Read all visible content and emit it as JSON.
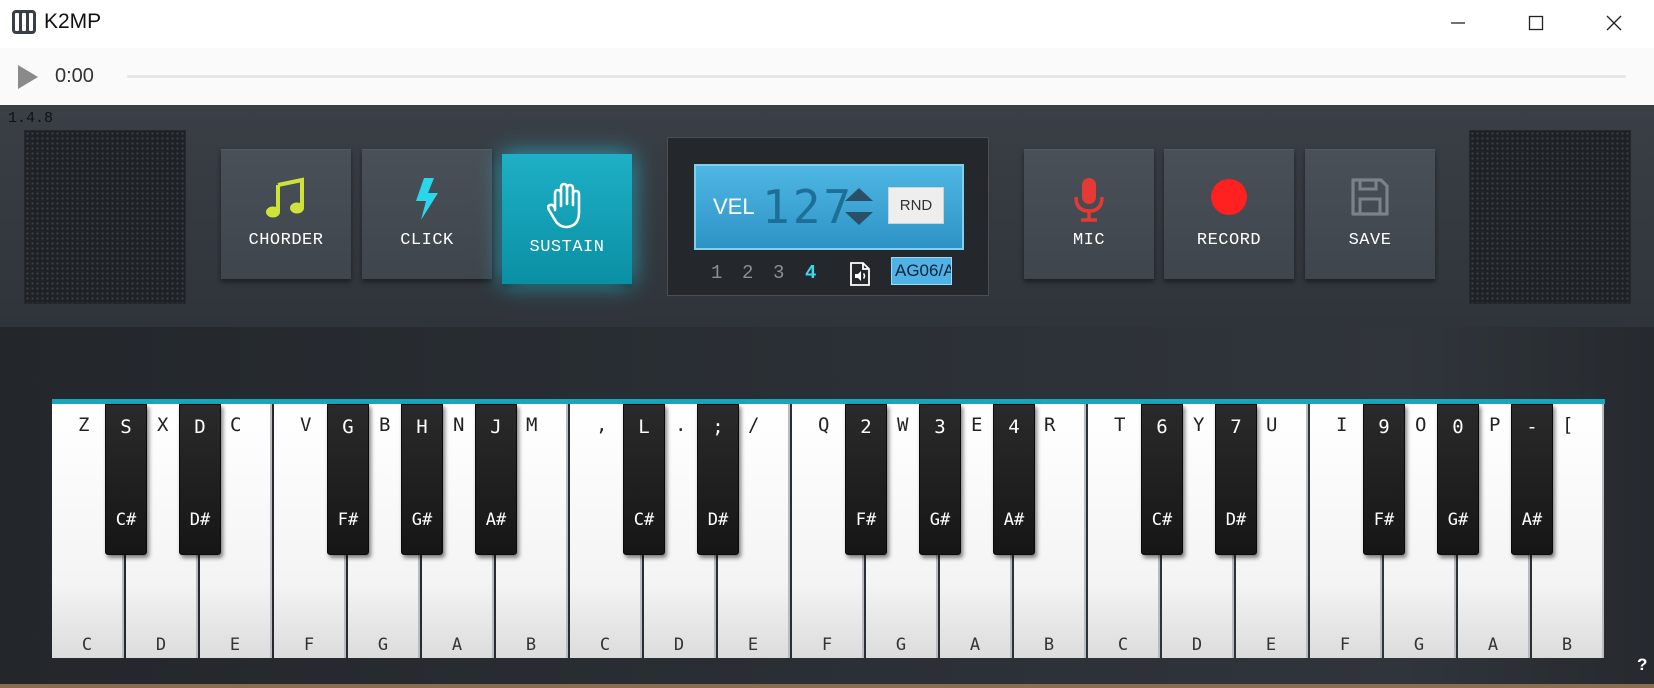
{
  "window": {
    "title": "K2MP"
  },
  "player": {
    "time": "0:00"
  },
  "version": "1.4.8",
  "controls": {
    "chorder": "CHORDER",
    "click": "CLICK",
    "sustain": "SUSTAIN",
    "mic": "MIC",
    "record": "RECORD",
    "save": "SAVE"
  },
  "velocity": {
    "label": "VEL",
    "value": "127",
    "rnd": "RND",
    "presets": [
      "1",
      "2",
      "3",
      "4"
    ],
    "active_preset": "4",
    "device": "AG06/A"
  },
  "colors": {
    "accent": "#1aa6b8",
    "sustain_active": "#12a2b8",
    "chorder_icon": "#cfe23a",
    "click_icon": "#2ad6ec",
    "mic_icon": "#e53935",
    "record_icon": "#ff2020",
    "save_icon": "#7d8288",
    "lcd": "#4fb7e3"
  },
  "keyboard": {
    "white_keys": [
      {
        "note": "C",
        "shortcut": "Z"
      },
      {
        "note": "D",
        "shortcut": "X"
      },
      {
        "note": "E",
        "shortcut": "C"
      },
      {
        "note": "F",
        "shortcut": "V"
      },
      {
        "note": "G",
        "shortcut": "B"
      },
      {
        "note": "A",
        "shortcut": "N"
      },
      {
        "note": "B",
        "shortcut": "M"
      },
      {
        "note": "C",
        "shortcut": ","
      },
      {
        "note": "D",
        "shortcut": "."
      },
      {
        "note": "E",
        "shortcut": "/"
      },
      {
        "note": "F",
        "shortcut": "Q"
      },
      {
        "note": "G",
        "shortcut": "W"
      },
      {
        "note": "A",
        "shortcut": "E"
      },
      {
        "note": "B",
        "shortcut": "R"
      },
      {
        "note": "C",
        "shortcut": "T"
      },
      {
        "note": "D",
        "shortcut": "Y"
      },
      {
        "note": "E",
        "shortcut": "U"
      },
      {
        "note": "F",
        "shortcut": "I"
      },
      {
        "note": "G",
        "shortcut": "O"
      },
      {
        "note": "A",
        "shortcut": "P"
      },
      {
        "note": "B",
        "shortcut": "["
      }
    ],
    "black_keys": [
      {
        "note": "C#",
        "shortcut": "S"
      },
      {
        "note": "D#",
        "shortcut": "D"
      },
      {
        "note": "F#",
        "shortcut": "G"
      },
      {
        "note": "G#",
        "shortcut": "H"
      },
      {
        "note": "A#",
        "shortcut": "J"
      },
      {
        "note": "C#",
        "shortcut": "L"
      },
      {
        "note": "D#",
        "shortcut": ";"
      },
      {
        "note": "F#",
        "shortcut": "2"
      },
      {
        "note": "G#",
        "shortcut": "3"
      },
      {
        "note": "A#",
        "shortcut": "4"
      },
      {
        "note": "C#",
        "shortcut": "6"
      },
      {
        "note": "D#",
        "shortcut": "7"
      },
      {
        "note": "F#",
        "shortcut": "9"
      },
      {
        "note": "G#",
        "shortcut": "0"
      },
      {
        "note": "A#",
        "shortcut": "-"
      }
    ]
  },
  "help": "?"
}
